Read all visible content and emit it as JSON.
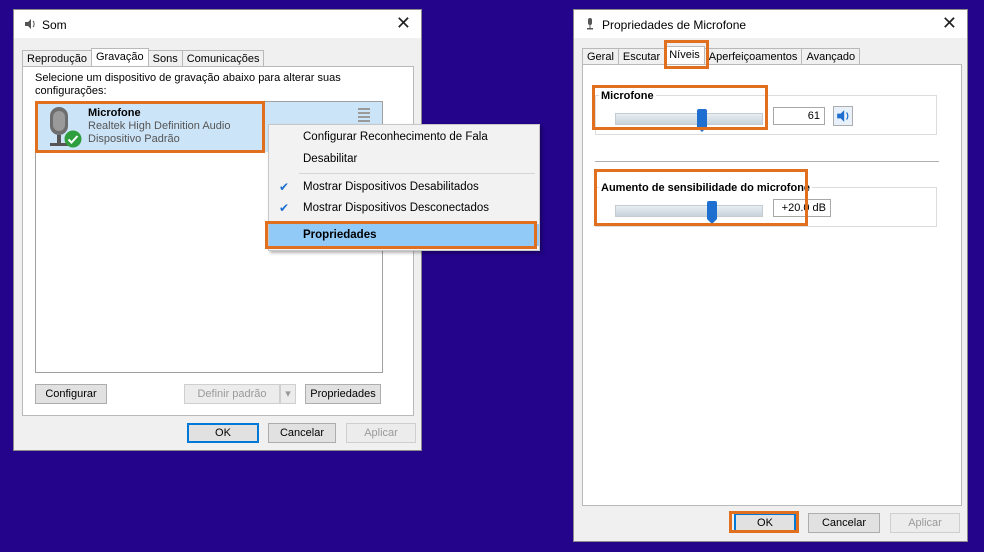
{
  "som": {
    "title": "Som",
    "tabs": [
      "Reprodução",
      "Gravação",
      "Sons",
      "Comunicações"
    ],
    "instruction": "Selecione um dispositivo de gravação abaixo para alterar suas configurações:",
    "device": {
      "name": "Microfone",
      "driver": "Realtek High Definition Audio",
      "status": "Dispositivo Padrão"
    },
    "buttons": {
      "configure": "Configurar",
      "set_default": "Definir padrão",
      "properties": "Propriedades",
      "ok": "OK",
      "cancel": "Cancelar",
      "apply": "Aplicar"
    }
  },
  "context_menu": {
    "items": [
      {
        "label": "Configurar Reconhecimento de Fala",
        "checked": false
      },
      {
        "label": "Desabilitar",
        "checked": false
      },
      {
        "label": "Mostrar Dispositivos Desabilitados",
        "checked": true
      },
      {
        "label": "Mostrar Dispositivos Desconectados",
        "checked": true
      },
      {
        "label": "Propriedades",
        "checked": false
      }
    ]
  },
  "props": {
    "title": "Propriedades de Microfone",
    "tabs": [
      "Geral",
      "Escutar",
      "Níveis",
      "Aperfeiçoamentos",
      "Avançado"
    ],
    "microfone": {
      "label": "Microfone",
      "value": "61",
      "level": 0.61
    },
    "boost": {
      "label": "Aumento de sensibilidade do microfone",
      "value": "+20.0 dB",
      "level": 0.67
    },
    "buttons": {
      "ok": "OK",
      "cancel": "Cancelar",
      "apply": "Aplicar"
    }
  },
  "colors": {
    "background": "#23048a",
    "highlight": "#e07020",
    "accent": "#0078d7"
  }
}
